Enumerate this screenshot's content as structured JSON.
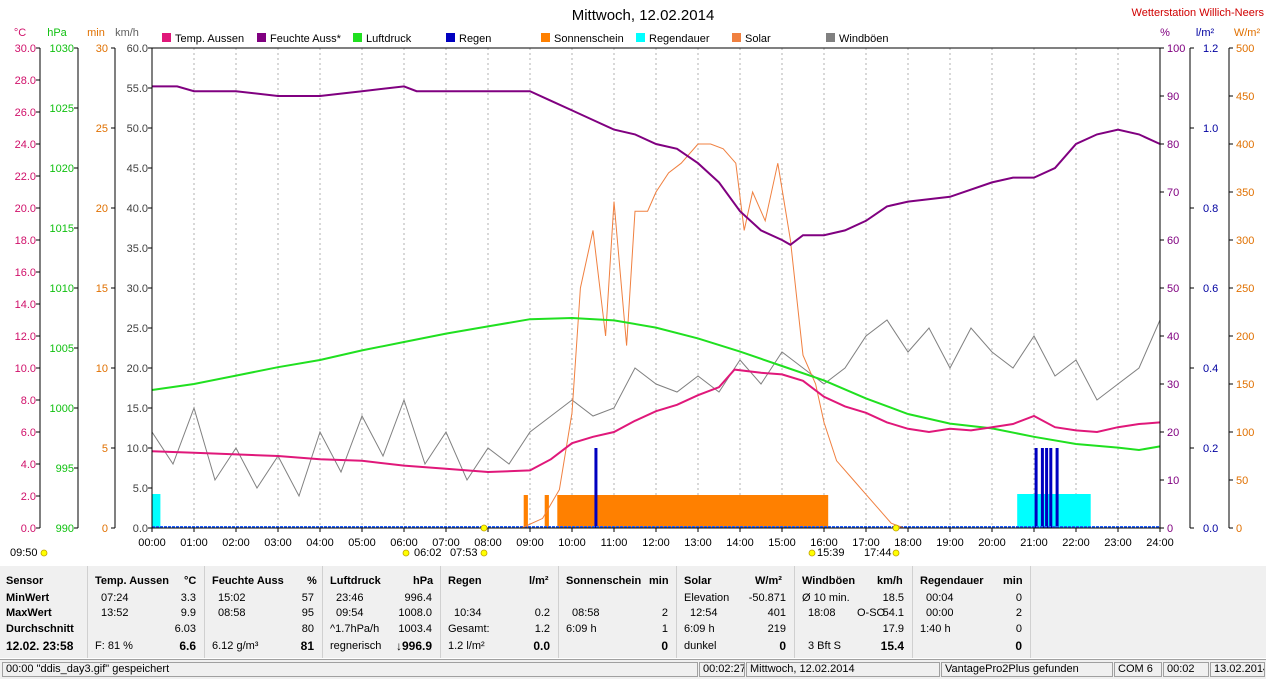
{
  "window": {
    "title": "Mittwoch, 12.02.2014",
    "station": "Wetterstation Willich-Neers"
  },
  "legend": [
    {
      "label": "Temp. Aussen",
      "color": "#e0187a"
    },
    {
      "label": "Feuchte Auss*",
      "color": "#800080"
    },
    {
      "label": "Luftdruck",
      "color": "#20e020"
    },
    {
      "label": "Regen",
      "color": "#0000c0"
    },
    {
      "label": "Sonnenschein",
      "color": "#ff8000"
    },
    {
      "label": "Regendauer",
      "color": "#00ffff"
    },
    {
      "label": "Solar",
      "color": "#f08040"
    },
    {
      "label": "Windböen",
      "color": "#808080"
    }
  ],
  "axes": {
    "units": {
      "temp": "°C",
      "pressure": "hPa",
      "sun": "min",
      "wind": "km/h",
      "hum": "%",
      "rain": "l/m²",
      "solar": "W/m²"
    },
    "temp_ticks": [
      "30.0",
      "28.0",
      "26.0",
      "24.0",
      "22.0",
      "20.0",
      "18.0",
      "16.0",
      "14.0",
      "12.0",
      "10.0",
      "8.0",
      "6.0",
      "4.0",
      "2.0",
      "0.0"
    ],
    "pressure_ticks": [
      "1030",
      "1025",
      "1020",
      "1015",
      "1010",
      "1005",
      "1000",
      "995",
      "990"
    ],
    "sun_ticks": [
      "30",
      "25",
      "20",
      "15",
      "10",
      "5",
      "0"
    ],
    "wind_ticks": [
      "60.0",
      "55.0",
      "50.0",
      "45.0",
      "40.0",
      "35.0",
      "30.0",
      "25.0",
      "20.0",
      "15.0",
      "10.0",
      "5.0",
      "0.0"
    ],
    "hum_ticks": [
      "100",
      "90",
      "80",
      "70",
      "60",
      "50",
      "40",
      "30",
      "20",
      "10",
      "0"
    ],
    "rain_ticks": [
      "1.2",
      "1.0",
      "0.8",
      "0.6",
      "0.4",
      "0.2",
      "0.0"
    ],
    "solar_ticks": [
      "500",
      "450",
      "400",
      "350",
      "300",
      "250",
      "200",
      "150",
      "100",
      "50",
      "0"
    ],
    "time_ticks": [
      "00:00",
      "01:00",
      "02:00",
      "03:00",
      "04:00",
      "05:00",
      "06:00",
      "07:00",
      "08:00",
      "09:00",
      "10:00",
      "11:00",
      "12:00",
      "13:00",
      "14:00",
      "15:00",
      "16:00",
      "17:00",
      "18:00",
      "19:00",
      "20:00",
      "21:00",
      "22:00",
      "23:00",
      "24:00"
    ]
  },
  "markers": {
    "m1": "09:50",
    "m2": "06:02",
    "m3": "07:53",
    "m4": "15:39",
    "m5": "17:44"
  },
  "chart_data": {
    "type": "line",
    "x_unit": "hours",
    "series": [
      {
        "name": "Temp. Aussen",
        "color": "#e0187a",
        "axis": "°C",
        "x": [
          0,
          1,
          2,
          3,
          4,
          5,
          6,
          7,
          8,
          9,
          9.5,
          10,
          10.5,
          11,
          11.5,
          12,
          12.5,
          13,
          13.5,
          13.87,
          14.5,
          15,
          15.5,
          16,
          16.5,
          17,
          17.5,
          18,
          18.5,
          19,
          19.5,
          20,
          20.5,
          21,
          21.5,
          22,
          22.5,
          23,
          23.5,
          24
        ],
        "y": [
          4.8,
          4.7,
          4.6,
          4.5,
          4.3,
          4.2,
          3.9,
          3.7,
          3.5,
          3.6,
          4.3,
          5.3,
          5.7,
          6.0,
          6.7,
          7.3,
          7.7,
          8.3,
          8.8,
          9.9,
          9.7,
          9.6,
          9.2,
          8.2,
          7.6,
          7.2,
          6.6,
          6.2,
          6.0,
          6.2,
          6.1,
          6.3,
          6.5,
          7.0,
          6.3,
          6.1,
          6.0,
          6.3,
          6.5,
          6.6
        ]
      },
      {
        "name": "Feuchte Auss*",
        "color": "#800080",
        "axis": "%",
        "x": [
          0,
          0.6,
          1,
          2,
          3,
          3.7,
          4,
          5,
          6,
          6.3,
          7,
          8,
          9,
          9.5,
          10,
          10.5,
          11,
          11.5,
          12,
          12.5,
          13,
          13.5,
          14,
          14.5,
          15,
          15.2,
          15.5,
          16,
          16.5,
          17,
          17.5,
          18,
          19,
          20,
          20.5,
          21,
          21.5,
          22,
          22.5,
          23,
          23.5,
          24
        ],
        "y": [
          92,
          92,
          91,
          91,
          90,
          90,
          90,
          91,
          92,
          91,
          91,
          91,
          91,
          89,
          87,
          85,
          83,
          82,
          80,
          79,
          76,
          72,
          66,
          62,
          60,
          59,
          61,
          61,
          62,
          64,
          67,
          68,
          69,
          72,
          73,
          73,
          75,
          80,
          82,
          83,
          82,
          80
        ]
      },
      {
        "name": "Luftdruck",
        "color": "#20e020",
        "axis": "hPa",
        "x": [
          0,
          1,
          2,
          3,
          4,
          5,
          6,
          7,
          8,
          9,
          10,
          11,
          12,
          13,
          14,
          15,
          16,
          17,
          18,
          19,
          20,
          21,
          22,
          23,
          23.5,
          24
        ],
        "y": [
          1001.5,
          1002.0,
          1002.7,
          1003.4,
          1004.0,
          1004.8,
          1005.5,
          1006.2,
          1006.8,
          1007.4,
          1007.5,
          1007.3,
          1006.7,
          1005.8,
          1004.7,
          1003.5,
          1002.3,
          1000.8,
          999.5,
          998.7,
          998.3,
          997.6,
          997.0,
          996.7,
          996.5,
          996.8
        ]
      },
      {
        "name": "Solar",
        "color": "#f08040",
        "axis": "W/m²",
        "x": [
          8.8,
          9.3,
          9.7,
          10,
          10.2,
          10.5,
          10.8,
          11,
          11.3,
          11.5,
          11.8,
          12,
          12.3,
          12.6,
          13,
          13.3,
          13.6,
          13.9,
          14.1,
          14.3,
          14.6,
          14.9,
          15.2,
          15.5,
          15.8,
          16,
          16.3,
          16.7,
          17,
          17.3,
          17.6,
          17.9
        ],
        "y": [
          0,
          10,
          40,
          120,
          250,
          310,
          200,
          340,
          190,
          330,
          330,
          350,
          370,
          380,
          400,
          400,
          395,
          380,
          310,
          350,
          320,
          380,
          300,
          180,
          150,
          110,
          70,
          50,
          35,
          20,
          5,
          0
        ]
      },
      {
        "name": "Windböen",
        "color": "#808080",
        "axis": "km/h",
        "x": [
          0,
          0.5,
          1,
          1.5,
          2,
          2.5,
          3,
          3.5,
          4,
          4.5,
          5,
          5.5,
          6,
          6.5,
          7,
          7.5,
          8,
          8.5,
          9,
          9.5,
          10,
          10.5,
          11,
          11.5,
          12,
          12.5,
          13,
          13.5,
          14,
          14.5,
          15,
          15.5,
          16,
          16.5,
          17,
          17.5,
          18,
          18.5,
          19,
          19.5,
          20,
          20.5,
          21,
          21.5,
          22,
          22.5,
          23,
          23.5,
          24
        ],
        "y": [
          12,
          8,
          15,
          6,
          10,
          5,
          9,
          4,
          12,
          7,
          14,
          9,
          16,
          8,
          12,
          6,
          10,
          8,
          12,
          14,
          16,
          14,
          15,
          20,
          18,
          17,
          19,
          17,
          21,
          18,
          22,
          20,
          18,
          20,
          24,
          26,
          22,
          25,
          20,
          25,
          22,
          20,
          24,
          19,
          21,
          16,
          18,
          20,
          26
        ]
      }
    ],
    "rain_bars": [
      {
        "x": 10.57,
        "value": 0.2
      },
      {
        "x": 21.05,
        "value": 0.2
      },
      {
        "x": 21.2,
        "value": 0.2
      },
      {
        "x": 21.3,
        "value": 0.2
      },
      {
        "x": 21.4,
        "value": 0.2
      },
      {
        "x": 21.55,
        "value": 0.2
      }
    ],
    "sunshine_blocks": [
      {
        "start": 8.85,
        "end": 8.95
      },
      {
        "start": 9.35,
        "end": 9.45
      },
      {
        "start": 9.65,
        "end": 16.1
      }
    ],
    "rain_duration_blocks": [
      {
        "start": 0.0,
        "end": 0.2
      },
      {
        "start": 20.6,
        "end": 22.35
      }
    ],
    "ylim_wind": [
      0,
      60
    ],
    "ylim_temp": [
      0,
      30
    ],
    "ylim_hum": [
      0,
      100
    ],
    "ylim_pressure": [
      990,
      1030
    ],
    "ylim_solar": [
      0,
      500
    ]
  },
  "table": {
    "sensor": {
      "h": "Sensor",
      "min": "MinWert",
      "max": "MaxWert",
      "avg": "Durchschnitt",
      "time": "12.02. 23:58"
    },
    "temp": {
      "h": "Temp. Aussen",
      "u": "°C",
      "min_t": "07:24",
      "min_v": "3.3",
      "max_t": "13:52",
      "max_v": "9.9",
      "avg": "6.03",
      "cur_l": "F: 81 %",
      "cur": "6.6"
    },
    "hum": {
      "h": "Feuchte Auss",
      "u": "%",
      "min_t": "15:02",
      "min_v": "57",
      "max_t": "08:58",
      "max_v": "95",
      "avg": "80",
      "cur_l": "6.12 g/m³",
      "cur": "81"
    },
    "press": {
      "h": "Luftdruck",
      "u": "hPa",
      "min_t": "23:46",
      "min_v": "996.4",
      "max_t": "09:54",
      "max_v": "1008.0",
      "avg_l": "^1.7hPa/h",
      "avg": "1003.4",
      "cur_l": "regnerisch",
      "cur": "↓996.9"
    },
    "rain": {
      "h": "Regen",
      "u": "l/m²",
      "max_t": "10:34",
      "max_v": "0.2",
      "tot_l": "Gesamt:",
      "tot": "1.2",
      "cur_l": "1.2 l/m²",
      "cur": "0.0"
    },
    "sun": {
      "h": "Sonnenschein",
      "u": "min",
      "max_t": "08:58",
      "max_v": "2",
      "avg_l": "6:09 h",
      "avg": "1",
      "cur": "0"
    },
    "solar": {
      "h": "Solar",
      "u": "W/m²",
      "min_l": "Elevation",
      "min_v": "-50.871",
      "max_t": "12:54",
      "max_v": "401",
      "avg_l": "6:09 h",
      "avg": "219",
      "cur_l": "dunkel",
      "cur": "0"
    },
    "wind": {
      "h": "Windböen",
      "u": "km/h",
      "min_l": "Ø 10 min.",
      "min_v": "18.5",
      "max_t": "18:08",
      "max_d": "O-SO",
      "max_v": "54.1",
      "avg": "17.9",
      "cur_l": "3 Bft S",
      "cur": "15.4"
    },
    "rdur": {
      "h": "Regendauer",
      "u": "min",
      "min_t": "00:04",
      "min_v": "0",
      "max_t": "00:00",
      "max_v": "2",
      "avg_l": "1:40 h",
      "avg": "0",
      "cur": "0"
    }
  },
  "status": {
    "s1": "00:00  \"ddis_day3.gif\"  gespeichert",
    "s2": "00:02:27",
    "s3": "Mittwoch, 12.02.2014",
    "s4": "VantagePro2Plus gefunden",
    "s5": "COM 6",
    "s6": "00:02",
    "s7": "13.02.2014"
  }
}
